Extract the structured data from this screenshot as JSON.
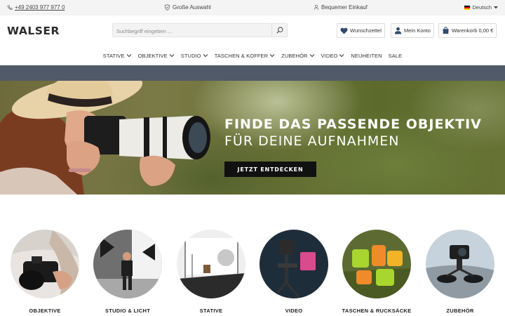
{
  "topbar": {
    "phone": "+49 2403 977 977 0",
    "usp_assortment": "Große Auswahl",
    "usp_shopping": "Bequemer Einkauf",
    "language": "Deutsch"
  },
  "header": {
    "logo": "WALSER",
    "search_placeholder": "Suchbegriff eingeben ...",
    "wishlist": "Wunschzettel",
    "account": "Mein Konto",
    "cart": "Warenkorb 0,00 €"
  },
  "nav": {
    "items": [
      "STATIVE",
      "OBJEKTIVE",
      "STUDIO",
      "TASCHEN & KOFFER",
      "ZUBEHÖR",
      "VIDEO",
      "NEUHEITEN",
      "SALE"
    ]
  },
  "hero": {
    "headline": "FINDE DAS PASSENDE OBJEKTIV",
    "subline": "FÜR DEINE AUFNAHMEN",
    "cta": "JETZT ENTDECKEN"
  },
  "categories": [
    "OBJEKTIVE",
    "STUDIO & LICHT",
    "STATIVE",
    "VIDEO",
    "TASCHEN & RUCKSÄCKE",
    "ZUBEHÖR"
  ],
  "colors": {
    "band": "#505a68",
    "cta": "#111111",
    "topbar": "#f4f4f4"
  },
  "icons": [
    "phone-icon",
    "shield-check-icon",
    "user-icon",
    "search-icon",
    "heart-icon",
    "account-icon",
    "cart-icon",
    "chevron-down-icon"
  ]
}
